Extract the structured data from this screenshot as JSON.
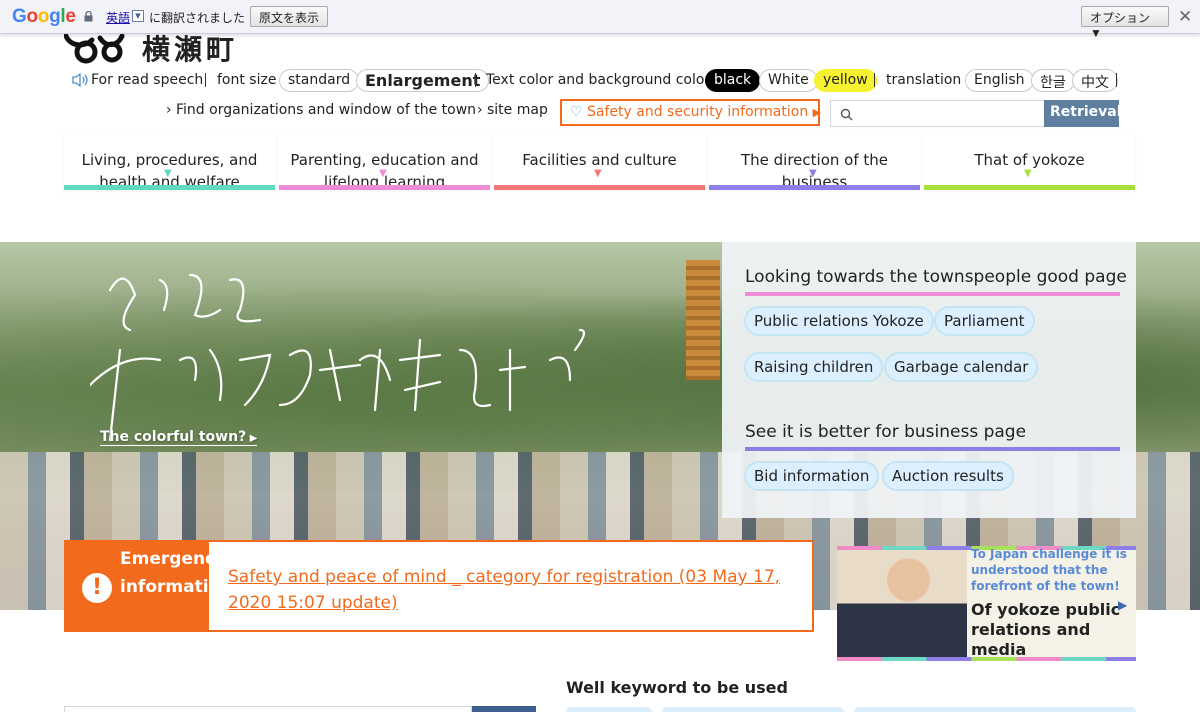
{
  "gtranslate": {
    "logo": "Google",
    "language": "英語",
    "translated_text": "に翻訳されました",
    "show_original": "原文を表示",
    "options": "オプション ▼",
    "close": "✕"
  },
  "header": {
    "logo_text": "横瀬町",
    "read_speech": "For read speech",
    "font_size_label": "font size",
    "font_standard": "standard",
    "font_enlargement": "Enlargement",
    "color_label": "Text color and background color",
    "color_black": "black",
    "color_white": "White",
    "color_yellow": "yellow",
    "translation_label": "translation",
    "lang_english": "English",
    "lang_korean": "한글",
    "lang_chinese": "中文",
    "find_org": "Find organizations and window of the town",
    "site_map": "site map",
    "safety": "Safety and security information",
    "search_button": "Retrieval",
    "search_value": ""
  },
  "nav": [
    {
      "label": "Living, procedures, and health and welfare",
      "color": "#5fd9c0"
    },
    {
      "label": "Parenting, education and lifelong learning",
      "color": "#f08bd8"
    },
    {
      "label": "Facilities and culture",
      "color": "#f07878"
    },
    {
      "label": "The direction of the business",
      "color": "#8e7ee8"
    },
    {
      "label": "That of yokoze",
      "color": "#a7e03a"
    }
  ],
  "hero": {
    "colorful_link": "The colorful town?"
  },
  "panel": {
    "townspeople_title": "Looking towards the townspeople good page",
    "townspeople_tags": [
      "Public relations Yokoze",
      "Parliament",
      "Raising children",
      "Garbage calendar"
    ],
    "business_title": "See it is better for business page",
    "business_tags": [
      "Bid information",
      "Auction results"
    ],
    "townspeople_color": "#f08bd8",
    "business_color": "#8e7ee8"
  },
  "emergency": {
    "title": "Emergency information",
    "link": "Safety and peace of mind _ category for registration (03 May 17, 2020 15:07 update)",
    "color": "#f26a1b"
  },
  "promo": {
    "subtitle": "To Japan challenge it is understood that the forefront of the town!",
    "title": "Of yokoze public relations and media"
  },
  "keywords": {
    "title": "Well keyword to be used"
  }
}
